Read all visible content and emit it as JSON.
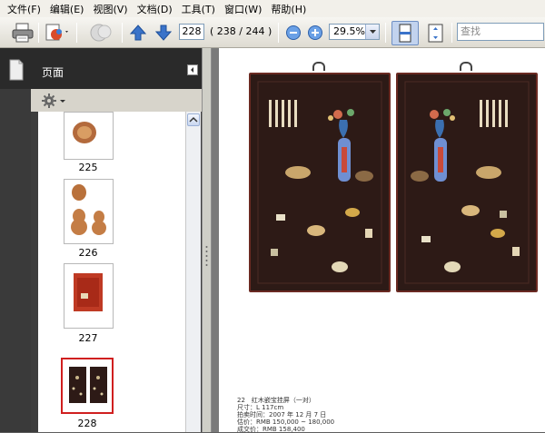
{
  "menu": [
    "文件(F)",
    "编辑(E)",
    "视图(V)",
    "文档(D)",
    "工具(T)",
    "窗口(W)",
    "帮助(H)"
  ],
  "toolbar": {
    "current_page": "228",
    "page_count": "( 238 / 244 )",
    "zoom": "29.5%",
    "search_placeholder": "查找"
  },
  "panel": {
    "title": "页面",
    "thumbnails": [
      {
        "label": "225"
      },
      {
        "label": "226"
      },
      {
        "label": "227"
      },
      {
        "label": "228"
      }
    ]
  },
  "document": {
    "caption": [
      "22　红木嵌宝挂屏（一对）",
      "尺寸：L 117cm",
      "拍卖时间：2007 年 12 月 7 日",
      "估价：RMB 150,000 ~ 180,000",
      "成交价：RMB 158,400"
    ]
  },
  "colors": {
    "selected_thumb_border": "#d01f1f",
    "panel_dark": "#2a2a2a",
    "board_wood": "#2d1a16"
  },
  "icons": [
    "printer-icon",
    "export-icon",
    "share-icon",
    "up-arrow-icon",
    "down-arrow-icon",
    "zoom-out-icon",
    "zoom-in-icon",
    "fit-page-icon",
    "full-screen-icon",
    "pages-icon",
    "gear-icon",
    "scroll-up-icon"
  ]
}
